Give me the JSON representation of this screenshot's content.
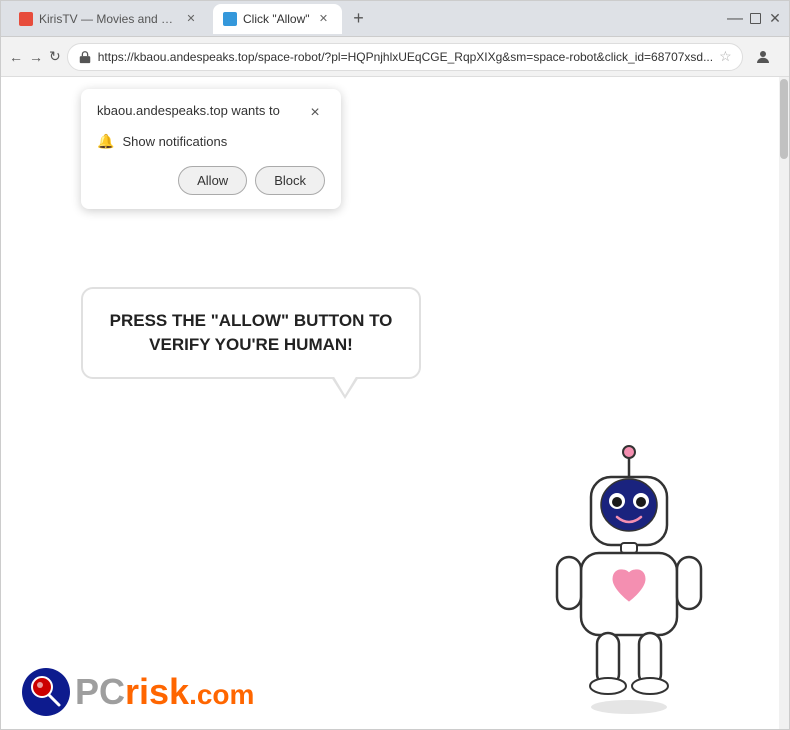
{
  "browser": {
    "tabs": [
      {
        "id": "tab1",
        "label": "KirisTV — Movies and Series D...",
        "active": false,
        "favicon_color": "#e74c3c"
      },
      {
        "id": "tab2",
        "label": "Click \"Allow\"",
        "active": true,
        "favicon_color": "#3498db"
      }
    ],
    "new_tab_label": "+",
    "url": "https://kbaou.andespeaks.top/space-robot/?pl=HQPnjhlxUEqCGE_RqpXIXg&sm=space-robot&click_id=68707xsd...",
    "nav": {
      "back": "←",
      "forward": "→",
      "refresh": "↻"
    },
    "window_controls": {
      "minimize": "—",
      "maximize": "□",
      "close": "✕"
    }
  },
  "notification_popup": {
    "title": "kbaou.andespeaks.top wants to",
    "close_btn": "×",
    "permission_label": "Show notifications",
    "allow_btn": "Allow",
    "block_btn": "Block"
  },
  "page": {
    "speech_bubble_text": "PRESS THE \"ALLOW\" BUTTON TO VERIFY YOU'RE HUMAN!"
  },
  "pcrisk": {
    "pc_text": "PC",
    "risk_text": "risk",
    "com_text": ".com"
  },
  "colors": {
    "accent_orange": "#ff6600",
    "accent_gray": "#9e9e9e",
    "browser_bg": "#dee1e6",
    "url_bg": "#ffffff",
    "popup_shadow": "rgba(0,0,0,0.2)"
  }
}
